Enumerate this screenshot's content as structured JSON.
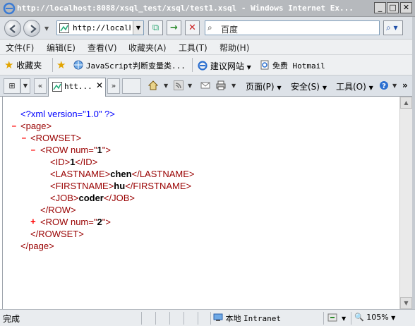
{
  "window": {
    "title": "http://localhost:8088/xsql_test/xsql/test1.xsql - Windows Internet Ex...",
    "buttons": {
      "minimize": "_",
      "maximize": "□",
      "close": "✕"
    }
  },
  "nav": {
    "address": "http://localhost",
    "search_placeholder": "百度"
  },
  "menu": [
    "文件(F)",
    "编辑(E)",
    "查看(V)",
    "收藏夹(A)",
    "工具(T)",
    "帮助(H)"
  ],
  "favorites_bar": {
    "favorites_label": "收藏夹",
    "links": [
      "JavaScript判断变量类...",
      "建议网站",
      "免费 Hotmail"
    ]
  },
  "tabs_bar": {
    "active_tab_title": "htt...",
    "commands": {
      "page": "页面(P)",
      "safety": "安全(S)",
      "tools": "工具(O)"
    }
  },
  "xml_doc": {
    "declaration": "<?xml version=\"1.0\" ?>",
    "lines": {
      "page_open": "<page>",
      "rowset_open": "<ROWSET>",
      "row1_open_tag": "<ROW num=\"",
      "row1_num": "1",
      "row1_close_quote": "\">",
      "id_open": "<ID>",
      "id_value": "1",
      "id_close": "</ID>",
      "lastname_open": "<LASTNAME>",
      "lastname_value": "chen",
      "lastname_close": "</LASTNAME>",
      "firstname_open": "<FIRSTNAME>",
      "firstname_value": "hu",
      "firstname_close": "</FIRSTNAME>",
      "job_open": "<JOB>",
      "job_value": "coder",
      "job_close": "</JOB>",
      "row_close": "</ROW>",
      "row2_open_tag": "<ROW num=\"",
      "row2_num": "2",
      "row2_close_quote": "\">",
      "rowset_close": "</ROWSET>",
      "page_close": "</page>"
    },
    "toggles": {
      "page": "–",
      "rowset": "–",
      "row1": "–",
      "row2": "+"
    }
  },
  "status": {
    "text": "完成",
    "zone_cn": "本地",
    "zone_en": "Intranet",
    "zoom": "105%"
  }
}
